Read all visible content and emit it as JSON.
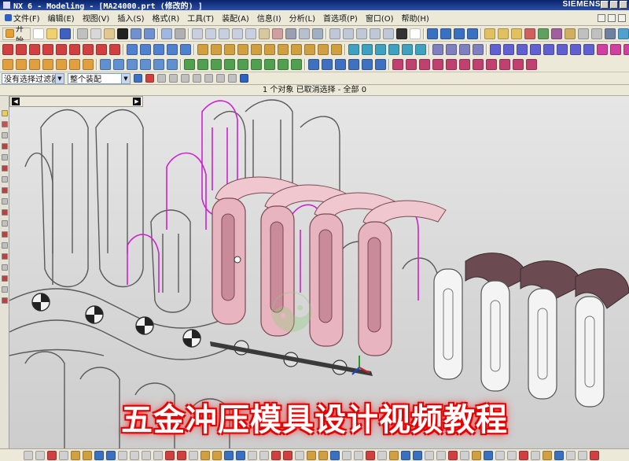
{
  "titlebar": {
    "title": "NX 6 - Modeling - [MA24000.prt (修改的) ]",
    "brand": "SIEMENS"
  },
  "menu": [
    "文件(F)",
    "编辑(E)",
    "视图(V)",
    "插入(S)",
    "格式(R)",
    "工具(T)",
    "装配(A)",
    "信息(I)",
    "分析(L)",
    "首选项(P)",
    "窗口(O)",
    "帮助(H)"
  ],
  "toolbar": {
    "start_label": "开始"
  },
  "filter": {
    "type_filter": "没有选择过滤器",
    "scope": "整个装配"
  },
  "status": {
    "text": "1 个对象 已取消选择 - 全部 0"
  },
  "banner": {
    "text": "五金冲压模具设计视频教程"
  },
  "icons": [
    "gear-icon",
    "start-icon",
    "file-new-icon",
    "file-open-icon",
    "save-icon",
    "cut-icon",
    "copy-icon",
    "paste-icon",
    "delete-icon",
    "undo-icon",
    "redo-icon",
    "scroll-left-icon",
    "scroll-right-icon",
    "cursor-icon"
  ],
  "colors": {
    "part": "#e8b4c0",
    "wire_magenta": "#d020d0",
    "wire_gray": "#5a5a5a",
    "banner_glow": "#ff1a1a"
  }
}
